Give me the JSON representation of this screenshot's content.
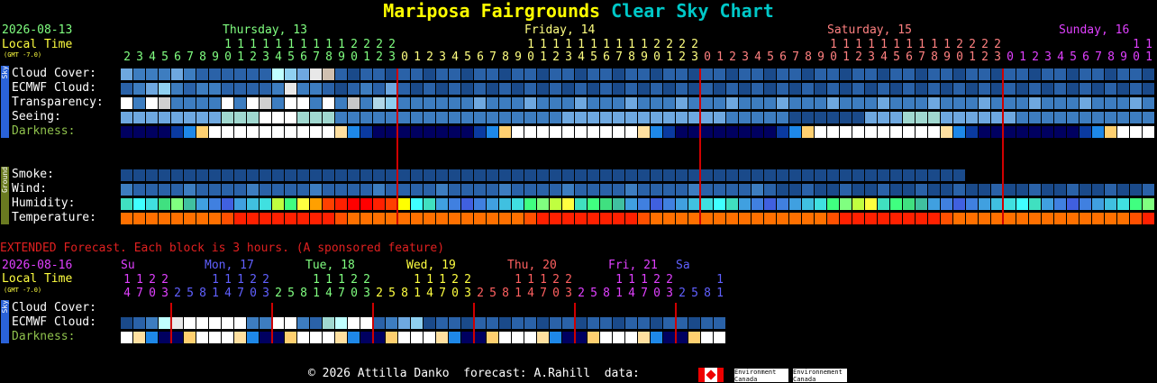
{
  "title": {
    "place": "Mariposa Fairgrounds",
    "suffix": "Clear Sky Chart",
    "place_color": "#ffff00",
    "suffix_color": "#00c8c8"
  },
  "header": {
    "date": "2026-08-13",
    "local_time": "Local Time",
    "gmt": "(GMT -7.0)",
    "days": [
      {
        "label": "Thursday, 13",
        "color": "#80ff80"
      },
      {
        "label": "Friday, 14",
        "color": "#ffff80"
      },
      {
        "label": "Saturday, 15",
        "color": "#ff8080"
      },
      {
        "label": "Sunday, 16",
        "color": "#e040ff"
      }
    ],
    "hours": [
      2,
      3,
      4,
      5,
      6,
      7,
      8,
      9,
      10,
      11,
      12,
      13,
      14,
      15,
      16,
      17,
      18,
      19,
      20,
      21,
      22,
      23,
      0,
      1,
      2,
      3,
      4,
      5,
      6,
      7,
      8,
      9,
      10,
      11,
      12,
      13,
      14,
      15,
      16,
      17,
      18,
      19,
      20,
      21,
      22,
      23,
      0,
      1,
      2,
      3,
      4,
      5,
      6,
      7,
      8,
      9,
      10,
      11,
      12,
      13,
      14,
      15,
      16,
      17,
      18,
      19,
      20,
      21,
      22,
      23,
      0,
      1,
      2,
      3,
      4,
      5,
      6,
      7,
      8,
      9,
      10,
      11
    ]
  },
  "rows_sky": [
    {
      "label": "Cloud Cover:",
      "color": "#ffffff"
    },
    {
      "label": "ECMWF Cloud:",
      "color": "#ffffff"
    },
    {
      "label": "Transparency:",
      "color": "#ffffff"
    },
    {
      "label": "Seeing:",
      "color": "#ffffff"
    },
    {
      "label": "Darkness:",
      "color": "#8ec04c"
    }
  ],
  "rows_ground": [
    {
      "label": "Smoke:",
      "color": "#ffffff"
    },
    {
      "label": "Wind:",
      "color": "#ffffff"
    },
    {
      "label": "Humidity:",
      "color": "#ffffff"
    },
    {
      "label": "Temperature:",
      "color": "#ffffff"
    }
  ],
  "side_labels": {
    "sky": "Sky",
    "ground": "Ground"
  },
  "extended": {
    "note": "EXTENDED Forecast. Each block is 3 hours. (A sponsored feature)",
    "date": "2026-08-16",
    "local_time": "Local Time",
    "gmt": "(GMT -7.0)",
    "days": [
      {
        "label": "Su",
        "color": "#e040ff"
      },
      {
        "label": "Mon, 17",
        "color": "#6060ff"
      },
      {
        "label": "Tue, 18",
        "color": "#80ff80"
      },
      {
        "label": "Wed, 19",
        "color": "#ffff40"
      },
      {
        "label": "Thu, 20",
        "color": "#ff6060"
      },
      {
        "label": "Fri, 21",
        "color": "#e040ff"
      },
      {
        "label": "Sa",
        "color": "#6060ff"
      }
    ],
    "hours": [
      14,
      17,
      20,
      23,
      2,
      5,
      8,
      11,
      14,
      17,
      20,
      23,
      2,
      5,
      8,
      11,
      14,
      17,
      20,
      23,
      2,
      5,
      8,
      11,
      14,
      17,
      20,
      23,
      2,
      5,
      8,
      11,
      14,
      17,
      20,
      23,
      2,
      5,
      8,
      11,
      14,
      17,
      20,
      23,
      2,
      5,
      8,
      11,
      14,
      17,
      20,
      23,
      2,
      5,
      8,
      11,
      14,
      17,
      20,
      23,
      2,
      5,
      8,
      11,
      14,
      17,
      20,
      23,
      2,
      5,
      8,
      11,
      14,
      17,
      20,
      23,
      2,
      5,
      8,
      11,
      14
    ],
    "rows": [
      {
        "label": "Cloud Cover:",
        "color": "#ffffff"
      },
      {
        "label": "ECMWF Cloud:",
        "color": "#ffffff"
      },
      {
        "label": "Darkness:",
        "color": "#8ec04c"
      }
    ]
  },
  "footer": {
    "credits": "© 2026 Attilla Danko  forecast: A.Rahill  data:",
    "ec1": "Environment\nCanada",
    "ec2": "Environnement\nCanada"
  },
  "chart_data": {
    "type": "heatmap",
    "series": [
      {
        "name": "Cloud Cover",
        "values": [
          "#6ea8e0",
          "#3d7dc0",
          "#3d7dc0",
          "#3d7dc0",
          "#6ea8e0",
          "#3d7dc0",
          "#3d7dc0",
          "#3d7dc0",
          "#2a62a8",
          "#2a62a8",
          "#2a62a8",
          "#2a62a8",
          "#5a98d8",
          "#5a98d8",
          "#5a98d8",
          "#5a98d8",
          "#5a98d8",
          "#5a98d8",
          "#5a98d8",
          "#5a98d8",
          "#5a98d8",
          "#5a98d8",
          "#5a98d8",
          "#2a62a8"
        ]
      }
    ]
  }
}
